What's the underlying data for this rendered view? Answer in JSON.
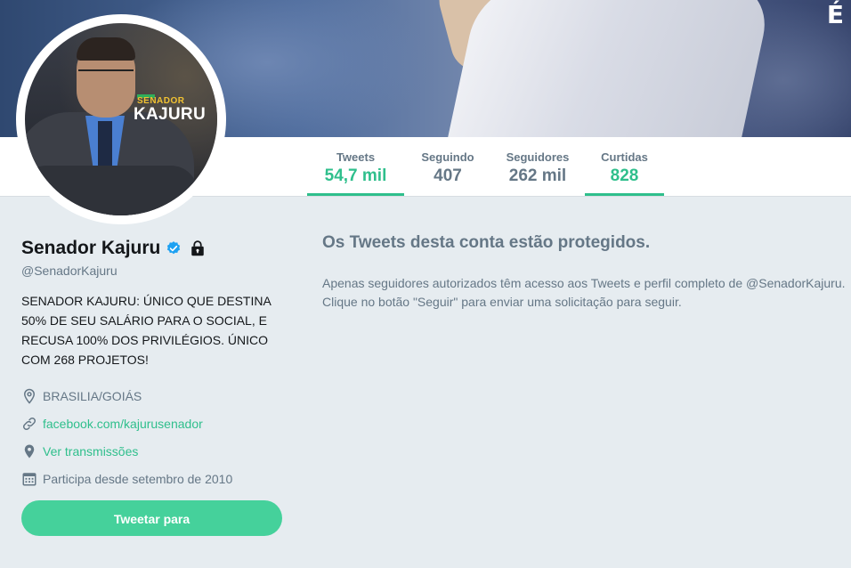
{
  "banner": {
    "corner_logo": "É"
  },
  "avatar": {
    "badge_top": "SENADOR",
    "badge_name": "KAJURU"
  },
  "nav": {
    "stats": [
      {
        "label": "Tweets",
        "value": "54,7 mil",
        "active": true
      },
      {
        "label": "Seguindo",
        "value": "407",
        "active": false
      },
      {
        "label": "Seguidores",
        "value": "262 mil",
        "active": false
      },
      {
        "label": "Curtidas",
        "value": "828",
        "active": false
      }
    ]
  },
  "profile": {
    "name": "Senador Kajuru",
    "handle": "@SenadorKajuru",
    "bio": "SENADOR KAJURU: ÚNICO QUE DESTINA 50% DE SEU SALÁRIO PARA O SOCIAL, E RECUSA 100% DOS PRIVILÉGIOS. ÚNICO COM 268 PROJETOS!",
    "location": "BRASILIA/GOIÁS",
    "website": "facebook.com/kajurusenador",
    "broadcasts": "Ver transmissões",
    "joined": "Participa desde setembro de 2010",
    "tweet_button": "Tweetar para"
  },
  "protected": {
    "title": "Os Tweets desta conta estão protegidos.",
    "message": "Apenas seguidores autorizados têm acesso aos Tweets e perfil completo de @SenadorKajuru. Clique no botão \"Seguir\" para enviar uma solicitação para seguir."
  },
  "colors": {
    "accent": "#2fbf8c",
    "button": "#45d19b",
    "background": "#e6ecf0",
    "muted": "#657786"
  },
  "icons": [
    "verified-icon",
    "lock-icon",
    "location-icon",
    "link-icon",
    "broadcast-icon",
    "calendar-icon"
  ]
}
